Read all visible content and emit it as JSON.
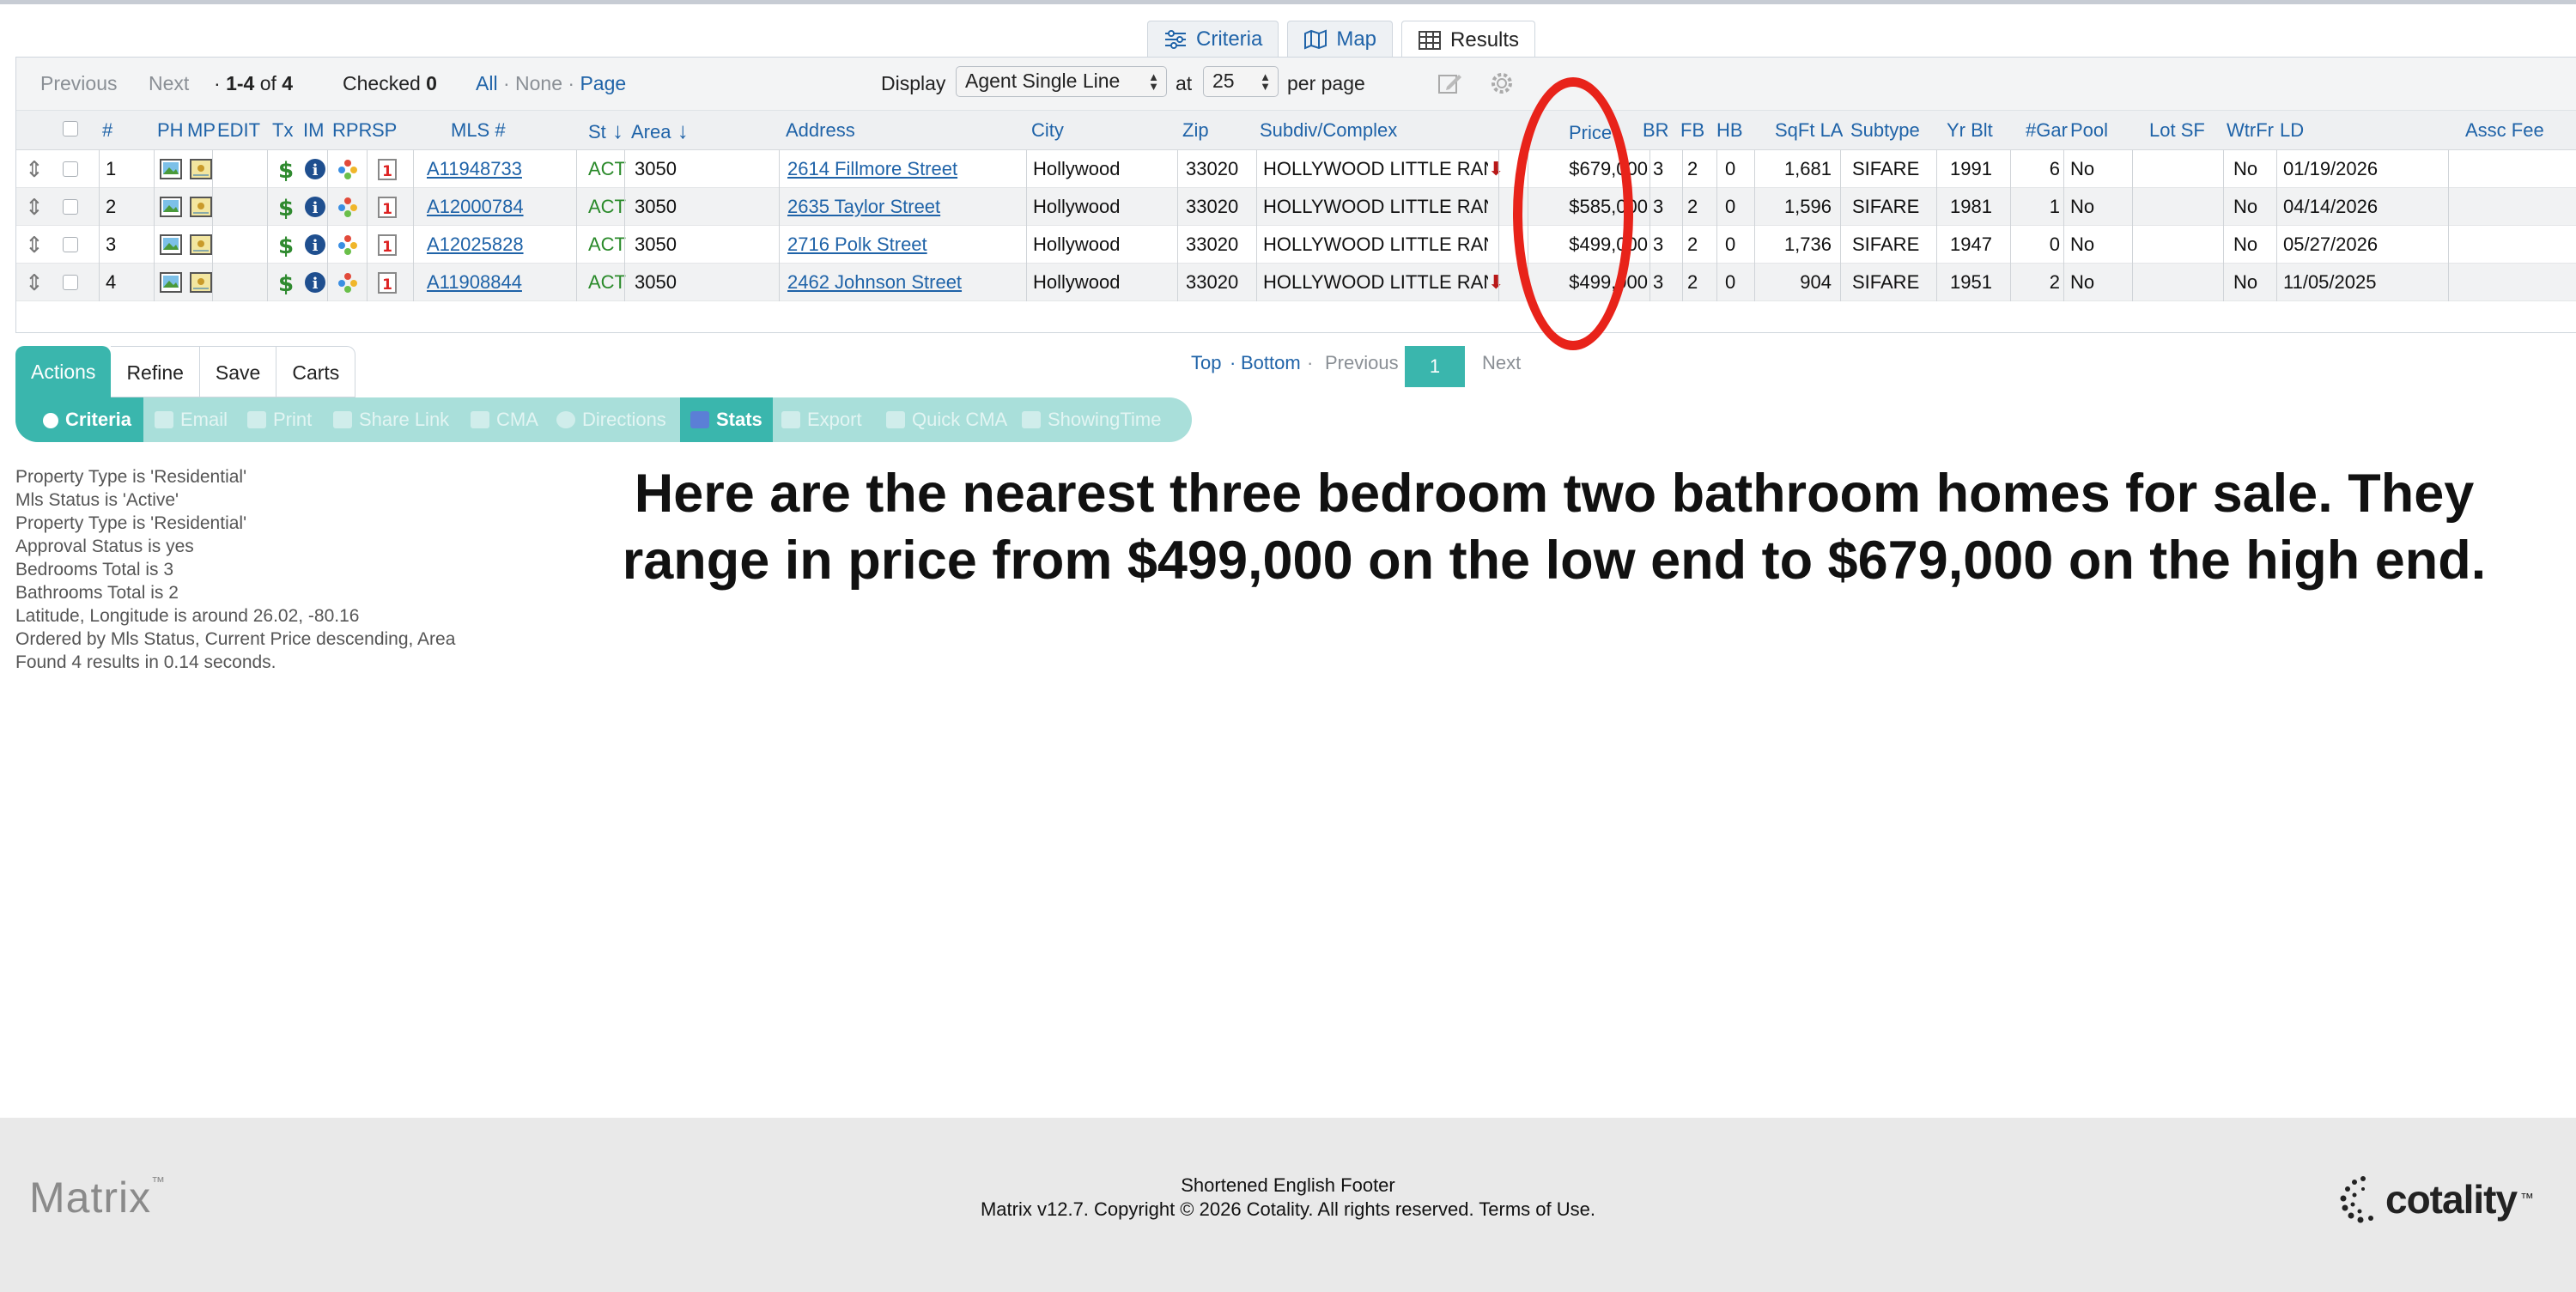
{
  "view_tabs": [
    {
      "label": "Criteria",
      "icon": "sliders-icon"
    },
    {
      "label": "Map",
      "icon": "map-icon"
    },
    {
      "label": "Results",
      "icon": "table-icon"
    }
  ],
  "pager": {
    "previous": "Previous",
    "next": "Next",
    "dot": "·",
    "range": "1-4",
    "of": "of",
    "total": "4",
    "checked_label": "Checked",
    "checked_count": "0",
    "all": "All",
    "none": "None",
    "page": "Page",
    "display_label": "Display",
    "display_value": "Agent Single Line",
    "at_label": "at",
    "per_page_value": "25",
    "per_page_label": "per page"
  },
  "columns": [
    "#",
    "PH",
    "MP",
    "EDIT",
    "Tx",
    "IM",
    "RPR",
    "SP",
    "MLS #",
    "St",
    "Area",
    "Address",
    "City",
    "Zip",
    "Subdiv/Complex",
    "Price",
    "BR",
    "FB",
    "HB",
    "SqFt LA",
    "Subtype",
    "Yr Blt",
    "#Gar",
    "Pool",
    "Lot SF",
    "WtrFr",
    "LD",
    "Assc Fee"
  ],
  "rows": [
    {
      "num": "1",
      "mls": "A11948733",
      "st": "ACT",
      "area": "3050",
      "address": "2614 Fillmore Street",
      "city": "Hollywood",
      "zip": "33020",
      "subdiv": "HOLLYWOOD LITTLE RAN",
      "price_drop": true,
      "price": "$679,000",
      "br": "3",
      "fb": "2",
      "hb": "0",
      "sqft": "1,681",
      "subtype": "SIFARE",
      "yrblt": "1991",
      "gar": "6",
      "pool": "No",
      "lotsf": "",
      "wtrfr": "No",
      "ld": "01/19/2026",
      "assc": ""
    },
    {
      "num": "2",
      "mls": "A12000784",
      "st": "ACT",
      "area": "3050",
      "address": "2635 Taylor Street",
      "city": "Hollywood",
      "zip": "33020",
      "subdiv": "HOLLYWOOD LITTLE RAN",
      "price_drop": false,
      "price": "$585,000",
      "br": "3",
      "fb": "2",
      "hb": "0",
      "sqft": "1,596",
      "subtype": "SIFARE",
      "yrblt": "1981",
      "gar": "1",
      "pool": "No",
      "lotsf": "",
      "wtrfr": "No",
      "ld": "04/14/2026",
      "assc": ""
    },
    {
      "num": "3",
      "mls": "A12025828",
      "st": "ACT",
      "area": "3050",
      "address": "2716 Polk Street",
      "city": "Hollywood",
      "zip": "33020",
      "subdiv": "HOLLYWOOD LITTLE RAN",
      "price_drop": false,
      "price": "$499,000",
      "br": "3",
      "fb": "2",
      "hb": "0",
      "sqft": "1,736",
      "subtype": "SIFARE",
      "yrblt": "1947",
      "gar": "0",
      "pool": "No",
      "lotsf": "",
      "wtrfr": "No",
      "ld": "05/27/2026",
      "assc": ""
    },
    {
      "num": "4",
      "mls": "A11908844",
      "st": "ACT",
      "area": "3050",
      "address": "2462 Johnson Street",
      "city": "Hollywood",
      "zip": "33020",
      "subdiv": "HOLLYWOOD LITTLE RAN",
      "price_drop": true,
      "price": "$499,000",
      "br": "3",
      "fb": "2",
      "hb": "0",
      "sqft": "904",
      "subtype": "SIFARE",
      "yrblt": "1951",
      "gar": "2",
      "pool": "No",
      "lotsf": "",
      "wtrfr": "No",
      "ld": "11/05/2025",
      "assc": ""
    }
  ],
  "action_tabs": [
    "Actions",
    "Refine",
    "Save",
    "Carts"
  ],
  "action_bar": [
    "Criteria",
    "Email",
    "Print",
    "Share Link",
    "CMA",
    "Directions",
    "Stats",
    "Export",
    "Quick CMA",
    "ShowingTime"
  ],
  "bottom_pager": {
    "top": "Top",
    "dot": "·",
    "bottom": "Bottom",
    "previous": "Previous",
    "page": "1",
    "next": "Next"
  },
  "criteria_lines": [
    "Property Type is 'Residential'",
    "Mls Status is 'Active'",
    "Property Type is 'Residential'",
    "Approval Status is yes",
    "Bedrooms Total is 3",
    "Bathrooms Total is 2",
    "Latitude, Longitude is around 26.02, -80.16",
    "Ordered by Mls Status, Current Price descending, Area",
    "Found 4 results in 0.14 seconds."
  ],
  "caption": {
    "line1": "Here are the nearest three bedroom two bathroom homes for sale. They",
    "line2": "range in price from $499,000 on the low end to $679,000 on the high end."
  },
  "footer": {
    "matrix_logo": "Matrix",
    "tm": "™",
    "line1": "Shortened English Footer",
    "line2": "Matrix v12.7. Copyright © 2026 Cotality. All rights reserved. Terms of Use.",
    "cotality_logo": "cotality",
    "tm2": "™"
  },
  "colors": {
    "accent": "#3ab6ad",
    "link": "#1f63a8",
    "highlight_circle": "#e8231a",
    "status_active": "#2a8a2a"
  }
}
